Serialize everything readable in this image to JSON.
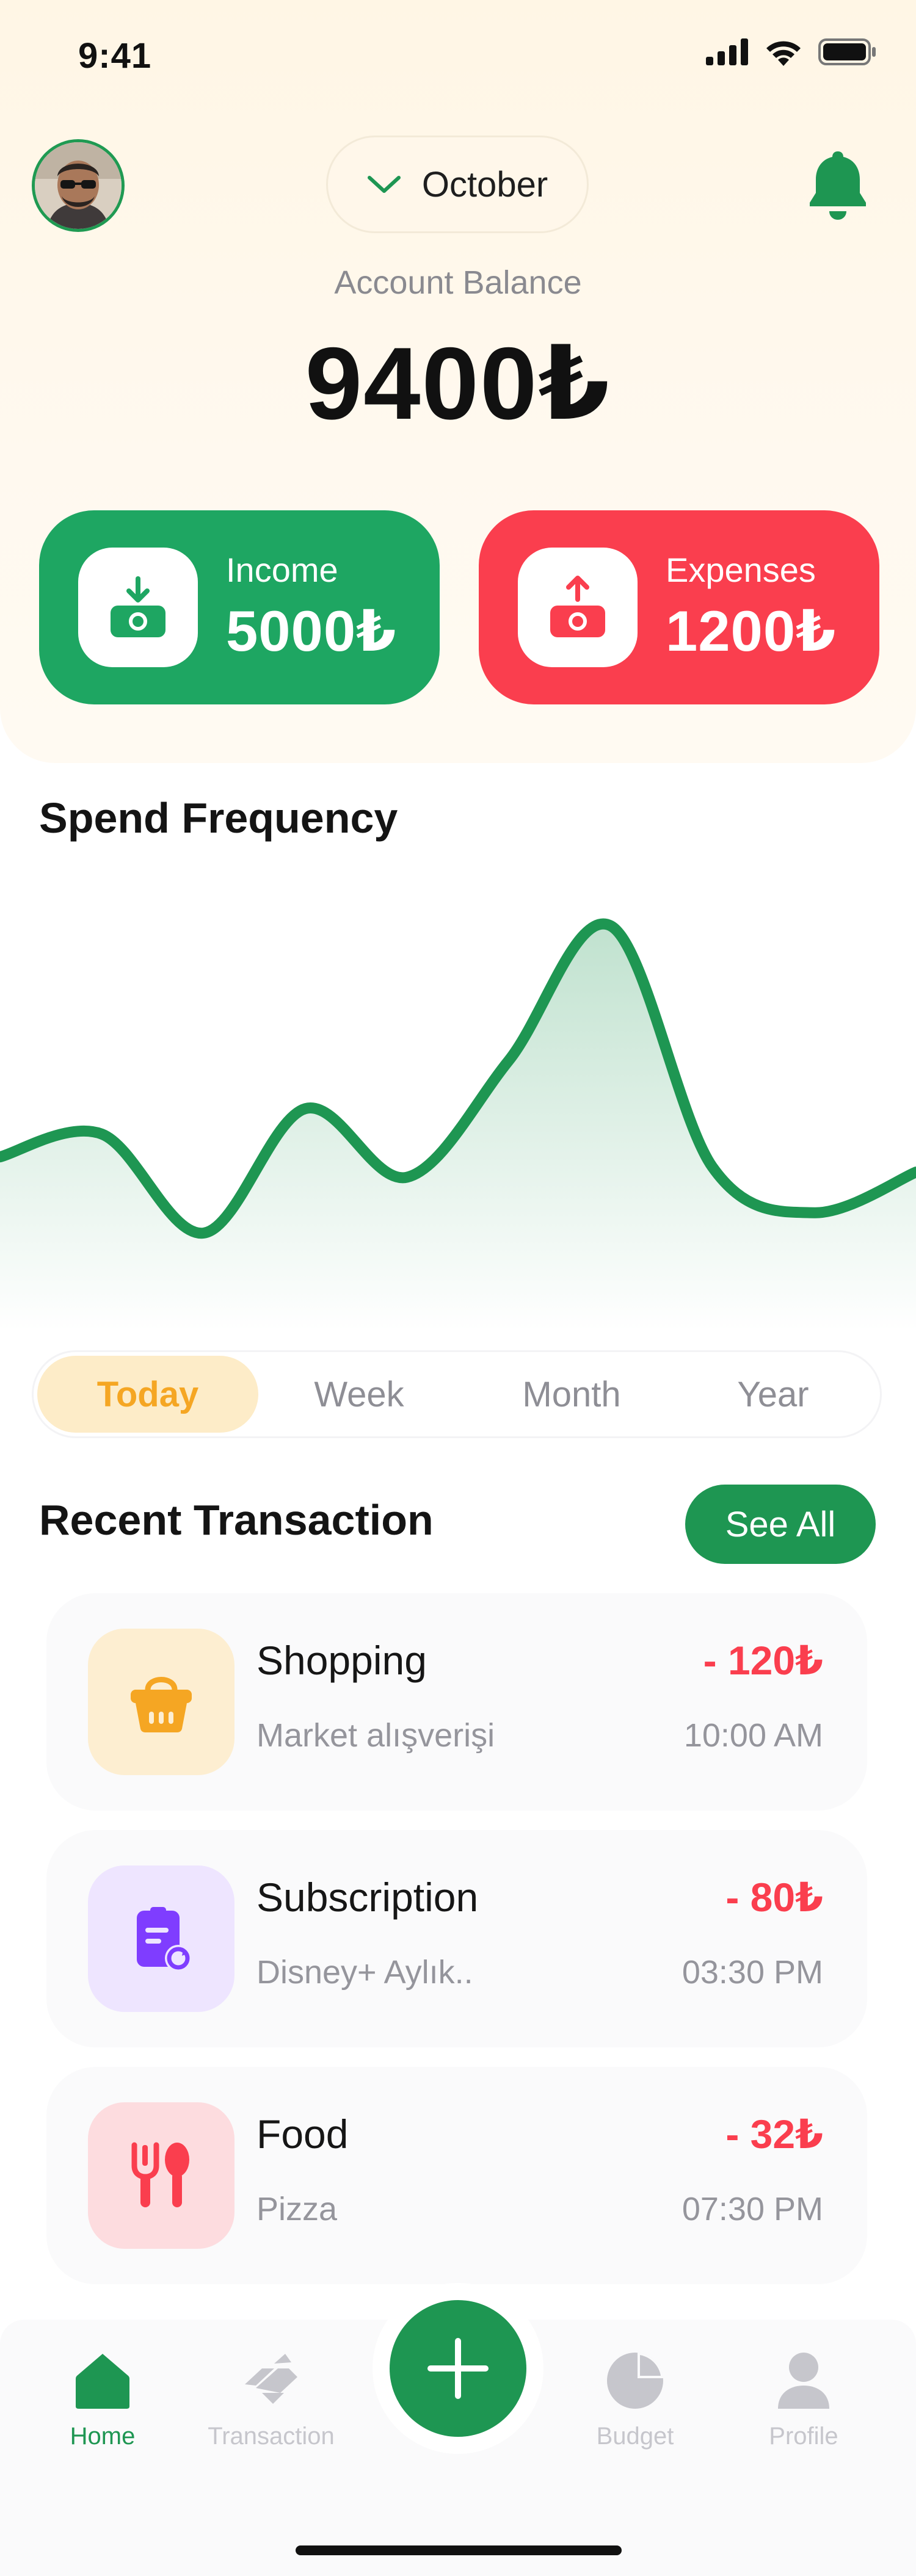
{
  "status_bar": {
    "time": "9:41"
  },
  "header": {
    "month": "October",
    "balance_label": "Account Balance",
    "balance_value": "9400₺"
  },
  "summary": {
    "income": {
      "label": "Income",
      "value": "5000₺",
      "color": "#1ea662",
      "icon": "wallet-download-icon"
    },
    "expenses": {
      "label": "Expenses",
      "value": "1200₺",
      "color": "#fa3e4e",
      "icon": "wallet-upload-icon"
    }
  },
  "spend_frequency": {
    "title": "Spend Frequency",
    "tabs": [
      "Today",
      "Week",
      "Month",
      "Year"
    ],
    "active_tab": "Today",
    "line_color": "#1e9652"
  },
  "chart_data": {
    "type": "line",
    "title": "Spend Frequency",
    "xlabel": "",
    "ylabel": "",
    "grid": false,
    "legend": "none",
    "x": [
      0,
      1,
      2,
      3,
      4,
      5,
      6,
      7,
      8,
      9
    ],
    "values": [
      3.0,
      3.9,
      0.0,
      4.9,
      2.2,
      6.8,
      12.1,
      2.6,
      0.8,
      2.4
    ]
  },
  "recent": {
    "title": "Recent Transaction",
    "see_all": "See All",
    "items": [
      {
        "title": "Shopping",
        "subtitle": "Market alışverişi",
        "amount": "- 120₺",
        "time": "10:00 AM",
        "icon": "shopping-basket-icon",
        "bg": "#fdeed1",
        "fg": "#f5a623"
      },
      {
        "title": "Subscription",
        "subtitle": "Disney+ Aylık..",
        "amount": "- 80₺",
        "time": "03:30 PM",
        "icon": "subscription-bill-icon",
        "bg": "#eee5ff",
        "fg": "#7f3dff"
      },
      {
        "title": "Food",
        "subtitle": "Pizza",
        "amount": "- 32₺",
        "time": "07:30 PM",
        "icon": "restaurant-icon",
        "bg": "#fddcdf",
        "fg": "#fa3e4e"
      }
    ]
  },
  "nav": {
    "items": [
      {
        "label": "Home",
        "icon": "home-icon",
        "active": true
      },
      {
        "label": "Transaction",
        "icon": "transaction-arrows-icon",
        "active": false
      },
      {
        "label": "Budget",
        "icon": "pie-chart-icon",
        "active": false
      },
      {
        "label": "Profile",
        "icon": "user-icon",
        "active": false
      }
    ],
    "add_icon": "plus-icon"
  }
}
